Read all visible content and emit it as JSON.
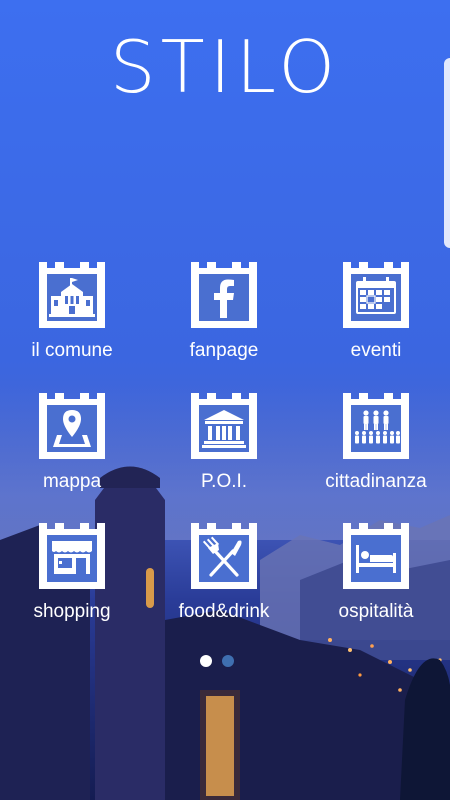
{
  "app": {
    "title": "STILO"
  },
  "colors": {
    "tile_blue": "#4a6fd0",
    "tile_white": "#ffffff",
    "sky_top": "#3d6ff0",
    "sky_bottom": "#1c2c74"
  },
  "menu": [
    {
      "label": "il comune",
      "icon": "town-hall-icon"
    },
    {
      "label": "fanpage",
      "icon": "facebook-icon"
    },
    {
      "label": "eventi",
      "icon": "calendar-icon"
    },
    {
      "label": "mappa",
      "icon": "map-pin-icon"
    },
    {
      "label": "P.O.I.",
      "icon": "monument-icon"
    },
    {
      "label": "cittadinanza",
      "icon": "citizens-icon"
    },
    {
      "label": "shopping",
      "icon": "shop-icon"
    },
    {
      "label": "food&drink",
      "icon": "fork-knife-icon"
    },
    {
      "label": "ospitalità",
      "icon": "bed-icon"
    }
  ],
  "pagination": {
    "current_page": 1,
    "total_pages": 2
  }
}
